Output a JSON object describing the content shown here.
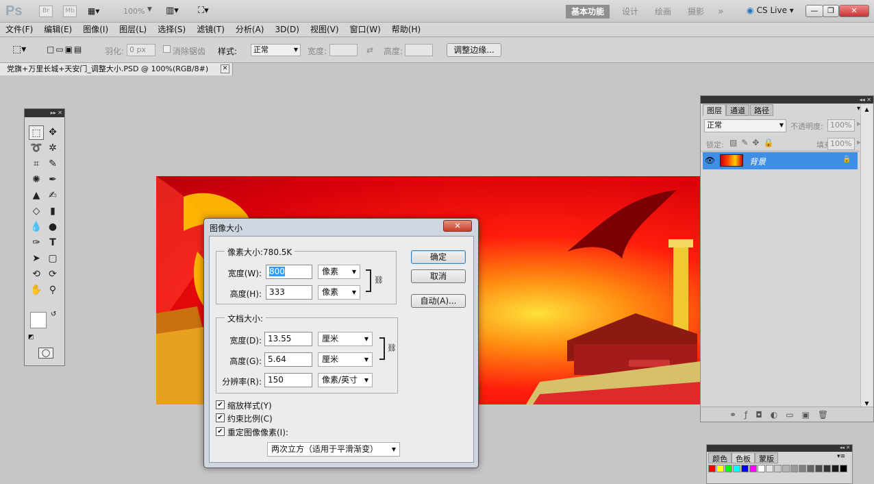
{
  "app": {
    "logo": "Ps",
    "bridge": "Br",
    "minibridge": "Mb",
    "zoom": "100%",
    "cs_live": "CS Live"
  },
  "workspaces": [
    "基本功能",
    "设计",
    "绘画",
    "摄影"
  ],
  "workspace_more": "»",
  "menu": [
    "文件(F)",
    "编辑(E)",
    "图像(I)",
    "图层(L)",
    "选择(S)",
    "滤镜(T)",
    "分析(A)",
    "3D(D)",
    "视图(V)",
    "窗口(W)",
    "帮助(H)"
  ],
  "options": {
    "feather_label": "羽化:",
    "feather_value": "0 px",
    "antialias_label": "消除锯齿",
    "style_label": "样式:",
    "style_value": "正常",
    "width_label": "宽度:",
    "height_label": "高度:",
    "refine_edge": "调整边缘..."
  },
  "document_tab": {
    "title": "党旗+万里长城+天安门_调整大小.PSD @ 100%(RGB/8#)"
  },
  "layers_panel": {
    "tabs": [
      "图层",
      "通道",
      "路径"
    ],
    "blend_mode": "正常",
    "opacity_label": "不透明度:",
    "opacity_value": "100%",
    "lock_label": "锁定:",
    "fill_label": "填充:",
    "fill_value": "100%",
    "layer_name": "背景"
  },
  "color_panel": {
    "tabs": [
      "颜色",
      "色板",
      "蒙版"
    ],
    "swatches": [
      "#ff0000",
      "#ffff00",
      "#00ff00",
      "#00ffff",
      "#0000ff",
      "#ff00ff",
      "#ffffff",
      "#e6e6e6",
      "#cccccc",
      "#b3b3b3",
      "#999999",
      "#808080",
      "#666666",
      "#4d4d4d",
      "#333333",
      "#1a1a1a",
      "#000000"
    ]
  },
  "dialog": {
    "title": "图像大小",
    "pixel_dims_label": "像素大小:780.5K",
    "width_label": "宽度(W):",
    "width_value": "800",
    "width_unit": "像素",
    "height_label": "高度(H):",
    "height_value": "333",
    "height_unit": "像素",
    "doc_size_label": "文档大小:",
    "doc_width_label": "宽度(D):",
    "doc_width_value": "13.55",
    "doc_width_unit": "厘米",
    "doc_height_label": "高度(G):",
    "doc_height_value": "5.64",
    "doc_height_unit": "厘米",
    "resolution_label": "分辨率(R):",
    "resolution_value": "150",
    "resolution_unit": "像素/英寸",
    "scale_styles": "缩放样式(Y)",
    "constrain": "约束比例(C)",
    "resample": "重定图像像素(I):",
    "resample_method": "两次立方（适用于平滑渐变）",
    "ok": "确定",
    "cancel": "取消",
    "auto": "自动(A)..."
  }
}
